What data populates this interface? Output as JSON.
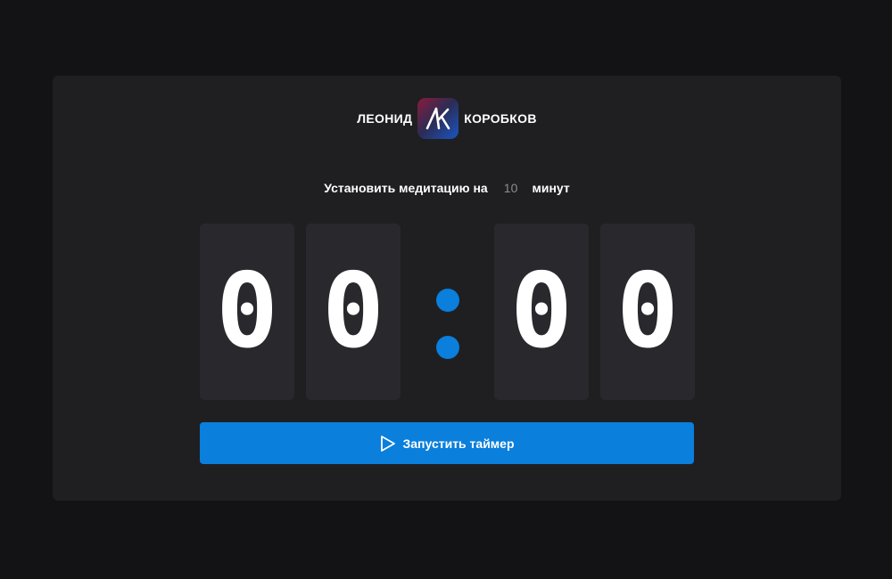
{
  "brand": {
    "first_name": "ЛЕОНИД",
    "last_name": "КОРОБКОВ",
    "logo_letters": "ЛК"
  },
  "setup": {
    "prefix": "Установить медитацию на",
    "minutes_value": "10",
    "suffix": "минут"
  },
  "timer": {
    "minutes_tens": "0",
    "minutes_ones": "0",
    "seconds_tens": "0",
    "seconds_ones": "0"
  },
  "start_button": {
    "label": "Запустить таймер",
    "icon": "play-icon"
  },
  "colors": {
    "background": "#131315",
    "panel": "#1f1f22",
    "digit_card": "#28282d",
    "accent": "#0a7fdc"
  }
}
